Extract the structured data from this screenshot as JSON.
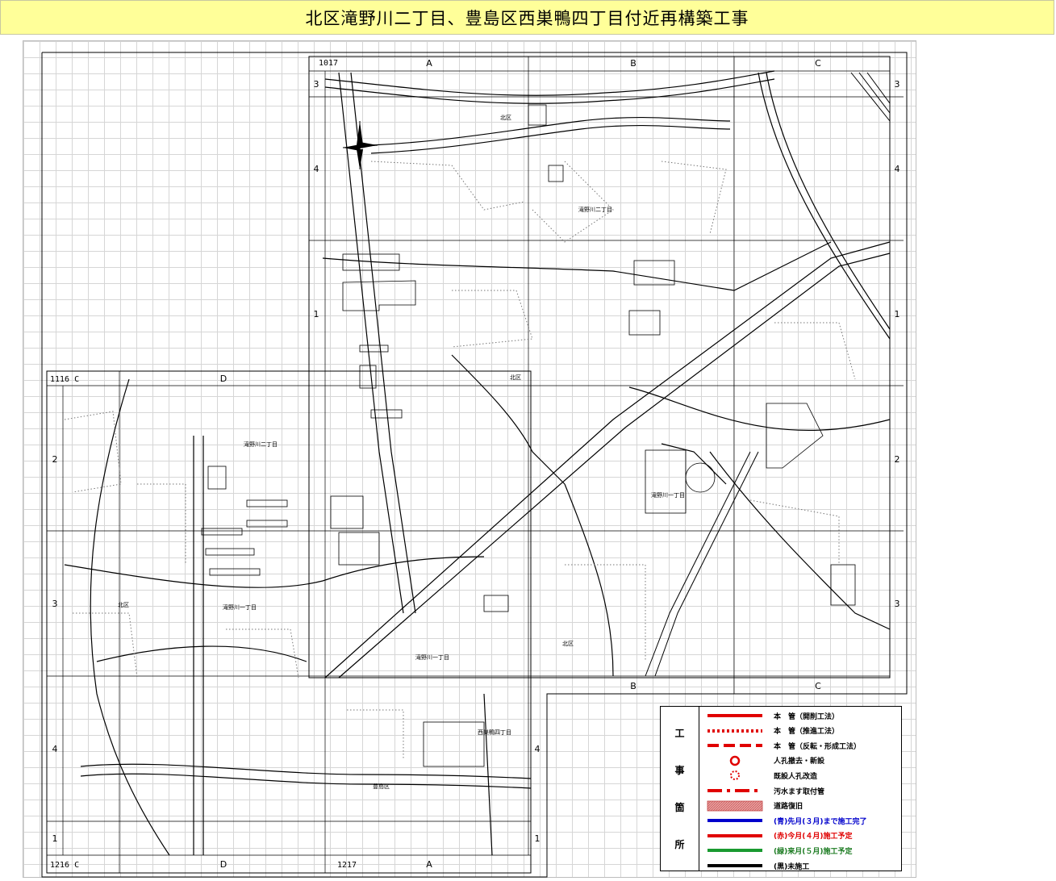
{
  "title": "北区滝野川二丁目、豊島区西巣鴨四丁目付近再構築工事",
  "sheets": {
    "upper": "1017",
    "lower_left": "1116 C",
    "bottom_left": "1216 C",
    "bottom_mid": "1217"
  },
  "grid": {
    "columns_upper": [
      "A",
      "B",
      "C"
    ],
    "columns_lower": [
      "D",
      "A"
    ],
    "columns_bottom_upper": [
      "B",
      "C"
    ],
    "rows_upper": [
      "3",
      "4",
      "1"
    ],
    "rows_lower": [
      "2",
      "3",
      "4",
      "1"
    ]
  },
  "place_labels": [
    {
      "text": "滝野川二丁目",
      "kind": "district"
    },
    {
      "text": "北区",
      "kind": "ward"
    },
    {
      "text": "滝野川一丁目",
      "kind": "district"
    },
    {
      "text": "西巣鴨四丁目",
      "kind": "district"
    },
    {
      "text": "豊島区",
      "kind": "ward"
    }
  ],
  "legend": {
    "heading": [
      "工",
      "事",
      "箇",
      "所"
    ],
    "items": [
      {
        "symbol": "solid-red",
        "color": "#e00000",
        "label": "本　管（開削工法）"
      },
      {
        "symbol": "dotted-red",
        "color": "#e00000",
        "label": "本　管（推進工法）"
      },
      {
        "symbol": "dashed-red",
        "color": "#e00000",
        "label": "本　管（反転・形成工法）"
      },
      {
        "symbol": "circle-solid",
        "color": "#e00000",
        "label": "人孔撤去・新設"
      },
      {
        "symbol": "circle-dotted",
        "color": "#e00000",
        "label": "既設人孔改造"
      },
      {
        "symbol": "dashdot-red",
        "color": "#e00000",
        "label": "汚水ます取付管"
      },
      {
        "symbol": "hatched-box",
        "color": "#e8a0a0",
        "label": "道路復旧"
      },
      {
        "symbol": "solid-blue",
        "color": "#0000cc",
        "label": "(青)先月(３月)まで施工完了",
        "label_color": "#0000cc"
      },
      {
        "symbol": "solid-red",
        "color": "#e00000",
        "label": "(赤)今月(４月)施工予定",
        "label_color": "#e00000"
      },
      {
        "symbol": "solid-green",
        "color": "#1a9a30",
        "label": "(緑)来月(５月)施工予定",
        "label_color": "#1a7a20"
      },
      {
        "symbol": "solid-black",
        "color": "#000000",
        "label": "(黒)未施工",
        "label_color": "#000000"
      }
    ]
  }
}
